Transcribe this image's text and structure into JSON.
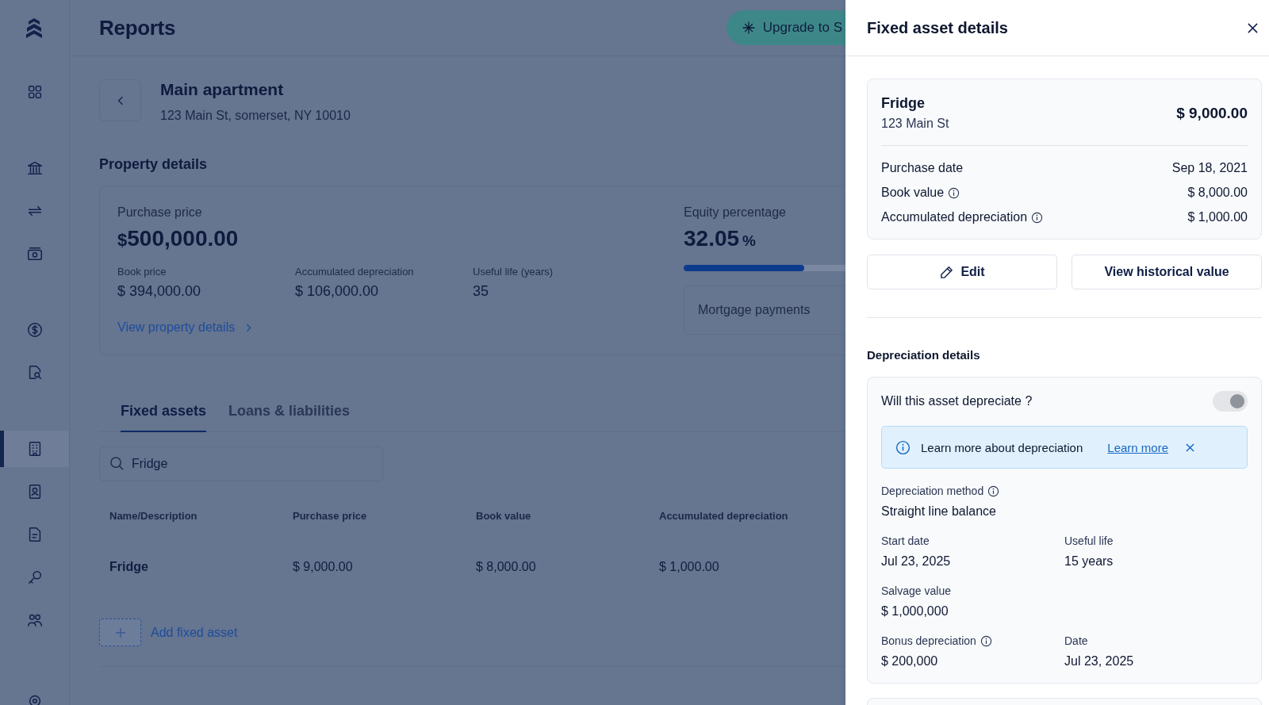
{
  "sidebar": {
    "groups": [
      {
        "items": [
          {
            "selected": false
          }
        ]
      },
      {
        "items": [
          {
            "selected": false
          },
          {
            "selected": false
          },
          {
            "selected": false
          }
        ]
      },
      {
        "items": [
          {
            "selected": false
          },
          {
            "selected": false
          }
        ]
      },
      {
        "items": [
          {
            "selected": true
          },
          {
            "selected": false
          },
          {
            "selected": false
          },
          {
            "selected": false
          },
          {
            "selected": false
          }
        ]
      },
      {
        "items": [
          {
            "selected": false
          }
        ]
      }
    ]
  },
  "header": {
    "title": "Reports",
    "upgrade_button": "Upgrade to S"
  },
  "property": {
    "name": "Main apartment",
    "address": "123 Main St, somerset, NY 10010"
  },
  "property_details": {
    "heading": "Property details",
    "purchase_price_label": "Purchase price",
    "purchase_price_currency": "$",
    "purchase_price": "500,000.00",
    "stats": [
      {
        "label": "Book price",
        "value": "$ 394,000.00"
      },
      {
        "label": "Accumulated depreciation",
        "value": "$ 106,000.00"
      },
      {
        "label": "Useful life (years)",
        "value": "35"
      }
    ],
    "link": "View property details",
    "equity": {
      "label": "Equity percentage",
      "value": "32.05",
      "unit": "%",
      "level": 0.3205
    },
    "mortgage": "Mortgage payments"
  },
  "tabs": [
    {
      "label": "Fixed assets",
      "selected": true
    },
    {
      "label": "Loans & liabilities",
      "selected": false
    }
  ],
  "search": {
    "value": "Fridge"
  },
  "table": {
    "columns": [
      "Name/Description",
      "Purchase price",
      "Book value",
      "Accumulated depreciation"
    ],
    "rows": [
      {
        "cells": [
          "Fridge",
          "$ 9,000.00",
          "$ 8,000.00",
          "$ 1,000.00"
        ]
      }
    ]
  },
  "add_button": "Add fixed asset",
  "panel": {
    "title": "Fixed asset details",
    "asset": {
      "name": "Fridge",
      "location": "123 Main St",
      "price": "$ 9,000.00",
      "rows": [
        {
          "label": "Purchase date",
          "value": "Sep 18, 2021",
          "info": false
        },
        {
          "label": "Book value",
          "value": "$ 8,000.00",
          "info": true
        },
        {
          "label": "Accumulated depreciation",
          "value": "$ 1,000.00",
          "info": true
        }
      ]
    },
    "edit_button": "Edit",
    "history_button": "View historical value",
    "depreciation": {
      "heading": "Depreciation details",
      "question": "Will this asset depreciate ?",
      "toggle": {
        "on": true
      },
      "banner": {
        "text": "Learn more about depreciation",
        "link": "Learn more"
      },
      "method_label": "Depreciation method",
      "method_info": true,
      "method_value": "Straight line balance",
      "field_rows": [
        [
          {
            "label": "Start date",
            "value": "Jul 23, 2025",
            "info": false
          },
          {
            "label": "Useful life",
            "value": "15 years",
            "info": false
          }
        ],
        [
          {
            "label": "Salvage value",
            "value": "$ 1,000,000",
            "info": false
          }
        ],
        [
          {
            "label": "Bonus depreciation",
            "value": "$ 200,000",
            "info": true
          },
          {
            "label": "Date",
            "value": "Jul 23, 2025",
            "info": false
          }
        ]
      ]
    }
  }
}
